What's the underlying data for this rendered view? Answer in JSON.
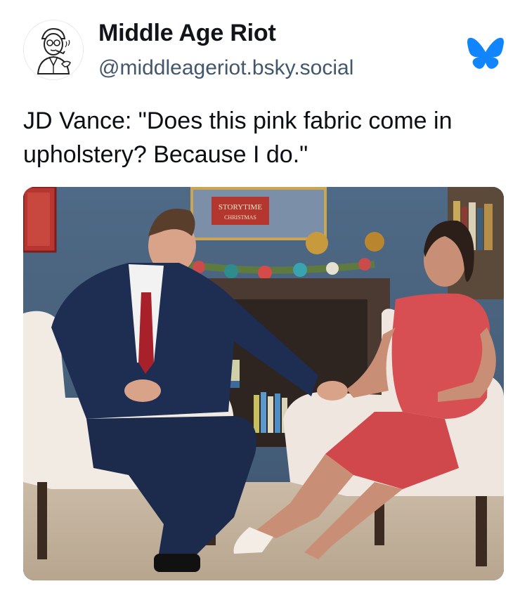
{
  "post": {
    "author_name": "Middle Age Riot",
    "author_handle": "@middleageriot.bsky.social",
    "text": "JD Vance: \"Does this pink fabric come in upholstery? Because I do.\"",
    "avatar_icon": "vintage-man-illustration",
    "network_icon": "bluesky-butterfly-icon",
    "brand_color": "#1185fe"
  },
  "media": {
    "type": "photo",
    "sign_text": "STORYTIME",
    "sign_subtext": "CHRISTMAS"
  }
}
